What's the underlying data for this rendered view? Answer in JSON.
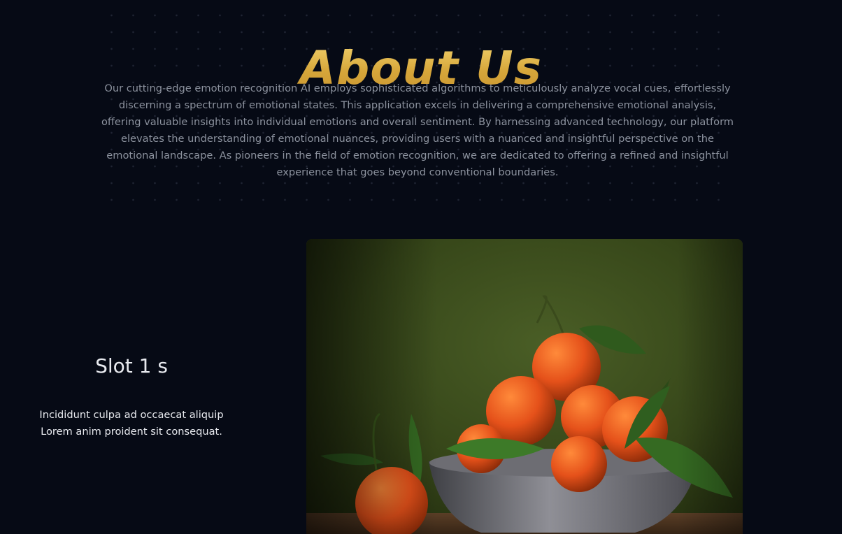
{
  "about": {
    "title": "About Us",
    "body": "Our cutting-edge emotion recognition AI employs sophisticated algorithms to meticulously analyze vocal cues, effortlessly discerning a spectrum of emotional states. This application excels in delivering a comprehensive emotional analysis, offering valuable insights into individual emotions and overall sentiment. By harnessing advanced technology, our platform elevates the understanding of emotional nuances, providing users with a nuanced and insightful perspective on the emotional landscape. As pioneers in the field of emotion recognition, we are dedicated to offering a refined and insightful experience that goes beyond conventional boundaries."
  },
  "slot": {
    "title": "Slot 1 s",
    "description": "Incididunt culpa ad occaecat aliquip Lorem anim proident sit consequat."
  },
  "colors": {
    "background": "#060a15",
    "title_gold": "#e1b74c",
    "body_text": "#8c929e",
    "slot_text": "#e8eaef"
  }
}
